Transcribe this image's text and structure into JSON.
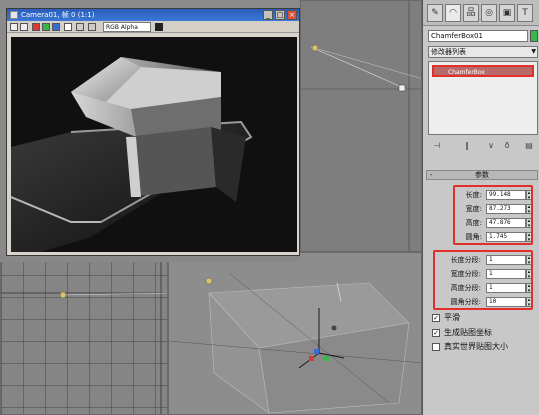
{
  "render_window": {
    "title": "Camera01, 帧 0 (1:1)",
    "channel": "RGB Alpha",
    "buttons": {
      "minimize": "_",
      "maximize": "□",
      "close": "×"
    }
  },
  "command_panel": {
    "object_name": "ChamferBox01",
    "modifier_list": "修改器列表",
    "stack_item": "ChamferBox",
    "rollout_title": "参数",
    "rollout_toggle": "-",
    "params": [
      {
        "label": "长度:",
        "value": "99.148"
      },
      {
        "label": "宽度:",
        "value": "87.273"
      },
      {
        "label": "高度:",
        "value": "47.876"
      },
      {
        "label": "圆角:",
        "value": "1.745"
      }
    ],
    "segments": [
      {
        "label": "长度分段:",
        "value": "1"
      },
      {
        "label": "宽度分段:",
        "value": "1"
      },
      {
        "label": "高度分段:",
        "value": "1"
      },
      {
        "label": "圆角分段:",
        "value": "10"
      }
    ],
    "options": [
      {
        "label": "平滑",
        "checked": true,
        "mark": "✓"
      },
      {
        "label": "生成贴图坐标",
        "checked": true,
        "mark": "✓"
      },
      {
        "label": "真实世界贴图大小",
        "checked": false,
        "mark": ""
      }
    ]
  },
  "icons": {
    "tabs": [
      "create-icon",
      "modify-icon",
      "hierarchy-icon",
      "motion-icon",
      "display-icon",
      "utilities-icon"
    ],
    "tab_glyphs": [
      "✎",
      "◠",
      "品",
      "◎",
      "▣",
      "T"
    ]
  },
  "colors": {
    "object_color": "#3cb54a",
    "highlight": "#e0302a"
  }
}
